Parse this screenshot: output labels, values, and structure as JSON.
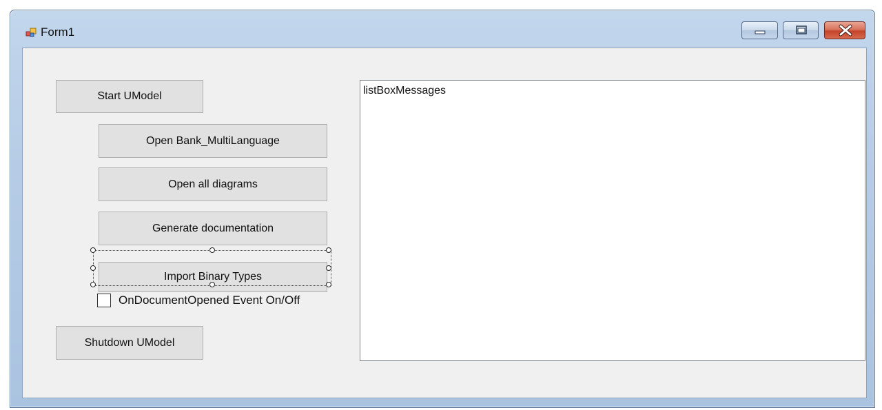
{
  "window": {
    "title": "Form1",
    "icon": "form-app-icon",
    "controls": [
      "minimize-icon",
      "maximize-icon",
      "close-icon"
    ],
    "colors": {
      "frame": "#b6cce6",
      "client": "#f0f0f0",
      "button": "#e1e1e1",
      "close": "#c4442b"
    }
  },
  "form": {
    "buttons": {
      "start": "Start UModel",
      "open_bank": "Open Bank_MultiLanguage",
      "open_diagrams": "Open all diagrams",
      "generate_docs": "Generate documentation",
      "import_binary": "Import Binary Types",
      "shutdown": "Shutdown UModel"
    },
    "checkbox": {
      "label": "OnDocumentOpened Event On/Off",
      "checked": false
    },
    "listbox": {
      "text": "listBoxMessages"
    }
  }
}
